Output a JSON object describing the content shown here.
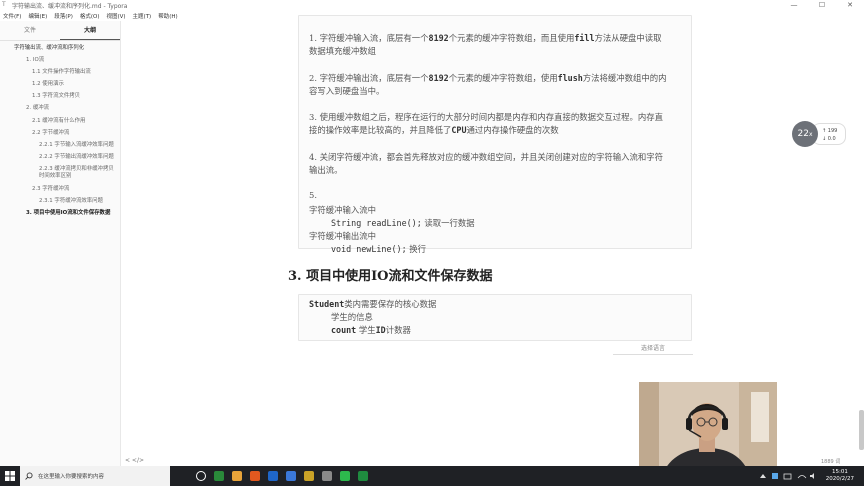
{
  "window": {
    "title": "字符输出流、缓冲流和序列化.md - Typora",
    "controls": [
      "—",
      "☐",
      "✕"
    ]
  },
  "menu": [
    "文件(F)",
    "编辑(E)",
    "段落(P)",
    "格式(O)",
    "视图(V)",
    "主题(T)",
    "帮助(H)"
  ],
  "sidebar": {
    "tabs": [
      "文件",
      "大纲"
    ],
    "active_tab": "大纲",
    "outline": [
      {
        "text": "字符输出流、缓冲流和序列化",
        "level": "l1"
      },
      {
        "text": "1. IO流",
        "level": "l2"
      },
      {
        "text": "1.1 文件操作字符输出流",
        "level": "l3"
      },
      {
        "text": "1.2 使用演示",
        "level": "l3"
      },
      {
        "text": "1.3 字符流文件拷贝",
        "level": "l3"
      },
      {
        "text": "2. 缓冲流",
        "level": "l2"
      },
      {
        "text": "2.1 缓冲流有什么作用",
        "level": "l3"
      },
      {
        "text": "2.2 字节缓冲流",
        "level": "l3"
      },
      {
        "text": "2.2.1 字节输入流缓冲效率问题",
        "level": "l4"
      },
      {
        "text": "2.2.2 字节输出流缓冲效率问题",
        "level": "l4"
      },
      {
        "text": "2.2.3 缓冲流拷贝和非缓冲拷贝时间效率区别",
        "level": "l4"
      },
      {
        "text": "2.3 字符缓冲流",
        "level": "l3"
      },
      {
        "text": "2.3.1 字符缓冲流效率问题",
        "level": "l4"
      },
      {
        "text": "3. 项目中使用IO流和文件保存数据",
        "level": "l1b"
      }
    ],
    "nav": "<  </>"
  },
  "content": {
    "block1": [
      {
        "parts": [
          [
            "t",
            "1. 字符缓冲输入流，底层有一个"
          ],
          [
            "m",
            "8192"
          ],
          [
            "t",
            "个元素的缓冲字符数组，而且使用"
          ],
          [
            "m",
            "fill"
          ],
          [
            "t",
            "方法从硬盘中读取"
          ]
        ]
      },
      {
        "parts": [
          [
            "t",
            "数据填充缓冲数组"
          ]
        ]
      },
      {
        "parts": [
          [
            "t",
            "2. 字符缓冲输出流，底层有一个"
          ],
          [
            "m",
            "8192"
          ],
          [
            "t",
            "个元素的缓冲字符数组，使用"
          ],
          [
            "m",
            "flush"
          ],
          [
            "t",
            "方法将缓冲数组中的内"
          ]
        ]
      },
      {
        "parts": [
          [
            "t",
            "容写入到硬盘当中。"
          ]
        ]
      },
      {
        "parts": [
          [
            "t",
            "3. 使用缓冲数组之后，程序在运行的大部分时间内都是内存和内存直接的数据交互过程。内存直"
          ]
        ]
      },
      {
        "parts": [
          [
            "t",
            "接的操作效率是比较高的，并且降低了"
          ],
          [
            "m",
            "CPU"
          ],
          [
            "t",
            "通过内存操作硬盘的次数"
          ]
        ]
      },
      {
        "parts": [
          [
            "t",
            "4. 关闭字符缓冲流，都会首先释放对应的缓冲数组空间，并且关闭创建对应的字符输入流和字符"
          ]
        ]
      },
      {
        "parts": [
          [
            "t",
            "输出流。"
          ]
        ]
      },
      {
        "parts": [
          [
            "t",
            "5."
          ]
        ]
      },
      {
        "parts": [
          [
            "t",
            "字符缓冲输入流中"
          ]
        ]
      },
      {
        "parts": [
          [
            "c",
            "String readLine();"
          ],
          [
            "t",
            " 读取一行数据"
          ]
        ],
        "indent": true
      },
      {
        "parts": [
          [
            "t",
            "字符缓冲输出流中"
          ]
        ]
      },
      {
        "parts": [
          [
            "c",
            "void newLine();"
          ],
          [
            "t",
            " 换行"
          ]
        ],
        "indent": true
      }
    ],
    "heading": "3. 项目中使用IO流和文件保存数据",
    "block2": [
      {
        "parts": [
          [
            "m",
            "Student"
          ],
          [
            "t",
            "类内需要保存的核心数据"
          ]
        ]
      },
      {
        "parts": [
          [
            "t",
            "学生的信息"
          ]
        ],
        "indent": true
      },
      {
        "parts": [
          [
            "m",
            "count"
          ],
          [
            "t",
            " 学生"
          ],
          [
            "m",
            "ID"
          ],
          [
            "t",
            "计数器"
          ]
        ],
        "indent": true
      }
    ],
    "language_select": "选择语言",
    "word_count": "1889 词"
  },
  "speed_widget": {
    "value": "22",
    "unit": "x",
    "up": "↑ 199",
    "down": "↓ 0.0"
  },
  "taskbar": {
    "search_placeholder": "在这里输入你要搜索的内容",
    "time": "15:01",
    "date": "2020/2/27",
    "app_colors": [
      "#ffffff",
      "#2a8a3a",
      "#e8a43a",
      "#e2581f",
      "#1f66c8",
      "#3b78d8",
      "#c9a227",
      "#8a8a8a",
      "#2db94d",
      "#1f8b3f"
    ]
  }
}
